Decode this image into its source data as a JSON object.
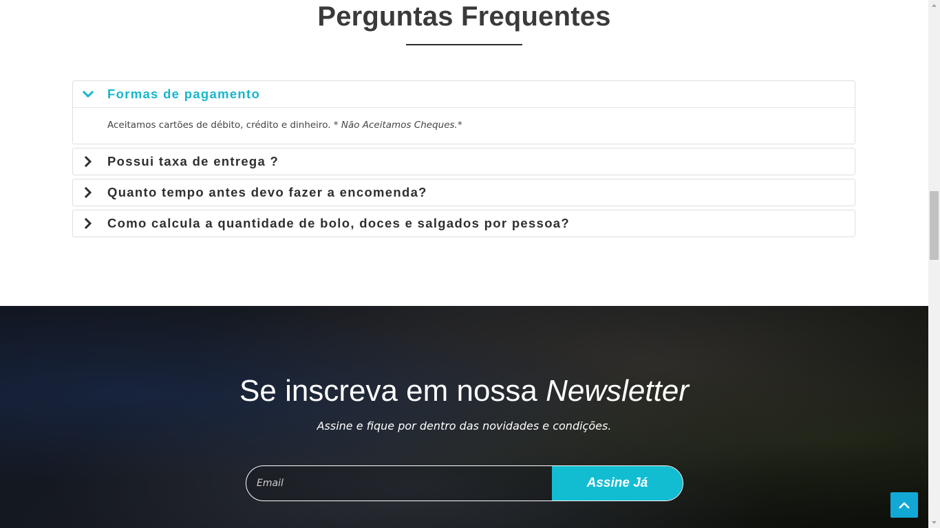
{
  "faq": {
    "title": "Perguntas Frequentes",
    "items": [
      {
        "question": "Formas de pagamento",
        "open": true,
        "answer_text": "Aceitamos cartões de débito, crédito e dinheiro. * ",
        "answer_emphasis": "Não Aceitamos Cheques.",
        "answer_suffix": "*"
      },
      {
        "question": "Possui taxa de entrega ?",
        "open": false
      },
      {
        "question": "Quanto tempo antes devo fazer a encomenda?",
        "open": false
      },
      {
        "question": "Como calcula a quantidade de bolo, doces e salgados por pessoa?",
        "open": false
      }
    ]
  },
  "newsletter": {
    "title_plain": "Se inscreva em nossa ",
    "title_emphasis": "Newsletter",
    "subtitle": "Assine e fique por dentro das novidades e condições.",
    "email_placeholder": "Email",
    "submit_label": "Assine Já"
  },
  "colors": {
    "accent": "#17b6cc",
    "button": "#12bdd2",
    "back_to_top": "#12a8d6"
  },
  "icons": {
    "open_item": "chevron-down-icon",
    "closed_item": "chevron-right-icon",
    "back_to_top": "chevron-up-icon"
  }
}
